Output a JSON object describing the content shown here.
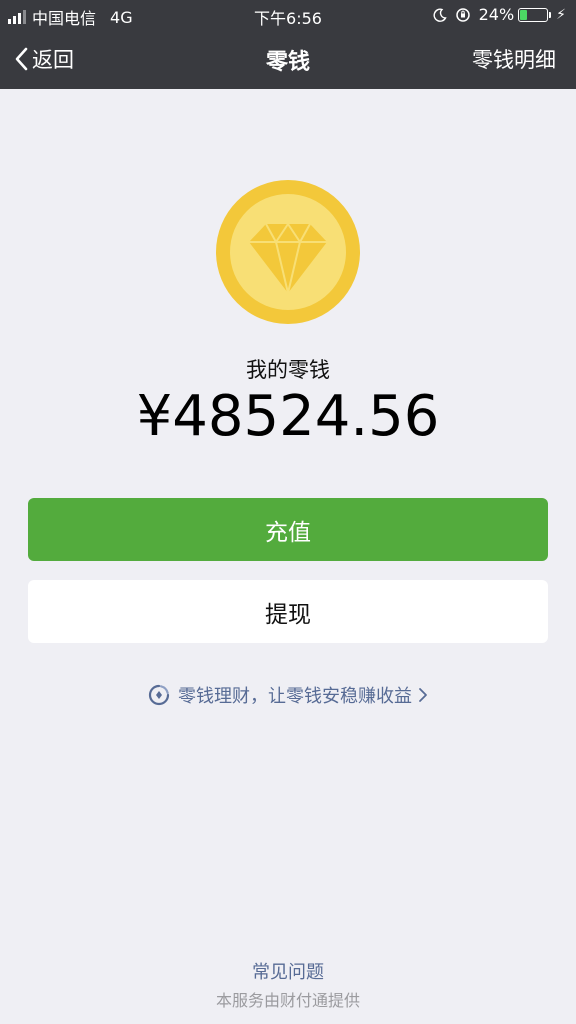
{
  "status_bar": {
    "carrier": "中国电信",
    "network": "4G",
    "time": "下午6:56",
    "battery_percent": "24%",
    "battery_level": 0.24,
    "battery_color": "#4cd964"
  },
  "nav": {
    "back_label": "返回",
    "title": "零钱",
    "right_label": "零钱明细"
  },
  "wallet": {
    "label": "我的零钱",
    "amount": "¥48524.56",
    "coin_icon": "diamond-coin-icon"
  },
  "actions": {
    "recharge_label": "充值",
    "withdraw_label": "提现"
  },
  "promo": {
    "text": "零钱理财，让零钱安稳赚收益"
  },
  "footer": {
    "faq_label": "常见问题",
    "provider_text": "本服务由财付通提供"
  },
  "colors": {
    "nav_bg": "#393a3f",
    "page_bg": "#efeff4",
    "primary_green": "#53ab3d",
    "link_blue": "#576b95",
    "coin_outer": "#f3c83a",
    "coin_inner": "#f8df75"
  }
}
